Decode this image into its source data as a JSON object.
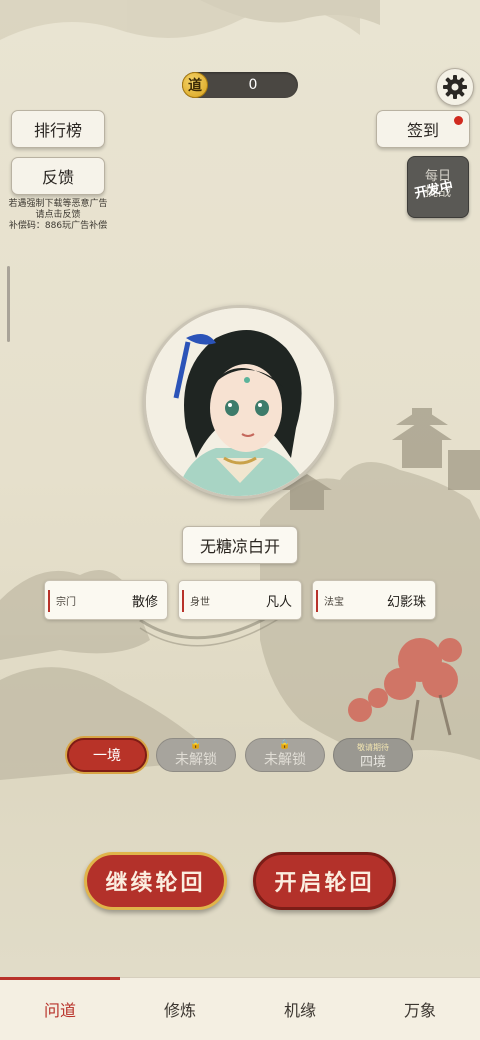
{
  "currency": {
    "badge": "道",
    "value": "0"
  },
  "icons": {
    "settings": "gear-icon",
    "lock": "lock-icon"
  },
  "buttons": {
    "rank": "排行榜",
    "feedback": "反馈",
    "sign_in": "签到",
    "continue": "继续轮回",
    "start": "开启轮回"
  },
  "daily_challenge": {
    "label": "每日\n挑战",
    "overlay": "开发中"
  },
  "notice": {
    "line1": "若遇强制下载等恶意广告",
    "line2": "请点击反馈",
    "line3": "补偿码：886玩广告补偿"
  },
  "player": {
    "name": "无糖凉白开"
  },
  "info_cards": [
    {
      "key": "宗门",
      "value": "散修"
    },
    {
      "key": "身世",
      "value": "凡人"
    },
    {
      "key": "法宝",
      "value": "幻影珠"
    }
  ],
  "realms": {
    "current": "一境",
    "locked": "未解锁",
    "future_tag": "敬请期待",
    "future": "四境"
  },
  "tabs": [
    "问道",
    "修炼",
    "机缘",
    "万象"
  ],
  "colors": {
    "accent": "#b8322a",
    "gold": "#e0b44a",
    "background": "#e6e0cc"
  }
}
